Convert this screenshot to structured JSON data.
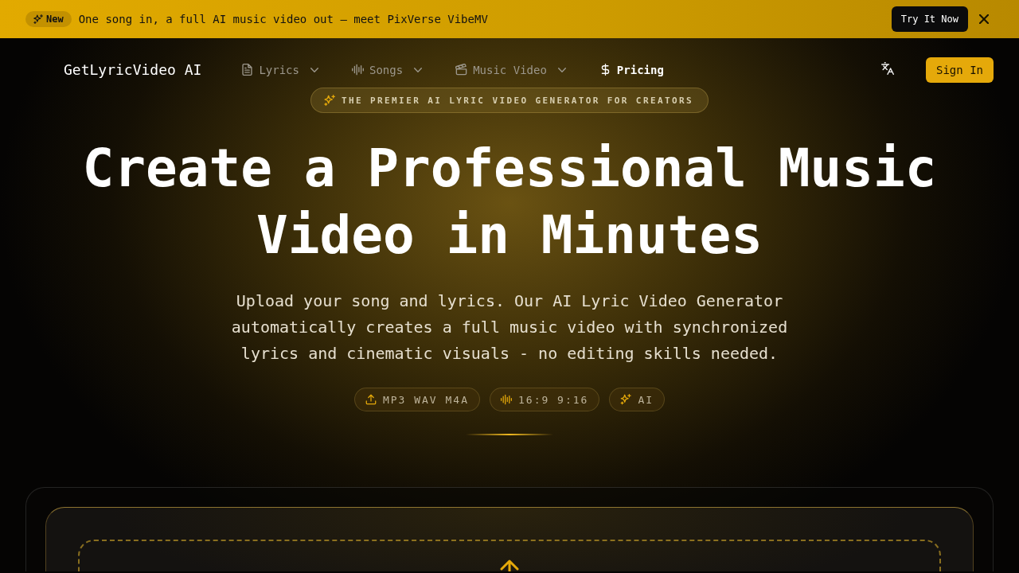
{
  "banner": {
    "badge": "New",
    "message": "One song in, a full AI music video out — meet PixVerse VibeMV",
    "action": "Try It Now"
  },
  "nav": {
    "logo": "GetLyricVideo AI",
    "items": [
      {
        "label": "Lyrics",
        "selected": false,
        "dropdown": true
      },
      {
        "label": "Songs",
        "selected": false,
        "dropdown": true
      },
      {
        "label": "Music Video",
        "selected": false,
        "dropdown": true
      },
      {
        "label": "Pricing",
        "selected": true,
        "dropdown": false
      }
    ],
    "sign_in": "Sign In"
  },
  "hero": {
    "tagline": "THE PREMIER AI LYRIC VIDEO GENERATOR FOR CREATORS",
    "title": "Create a Professional Music Video in Minutes",
    "description": "Upload your song and lyrics. Our AI Lyric Video Generator automatically creates a full music video with synchronized lyrics and cinematic visuals - no editing skills needed.",
    "chips": [
      {
        "label": "MP3 WAV M4A"
      },
      {
        "label": "16:9 9:16"
      },
      {
        "label": "AI"
      }
    ]
  }
}
